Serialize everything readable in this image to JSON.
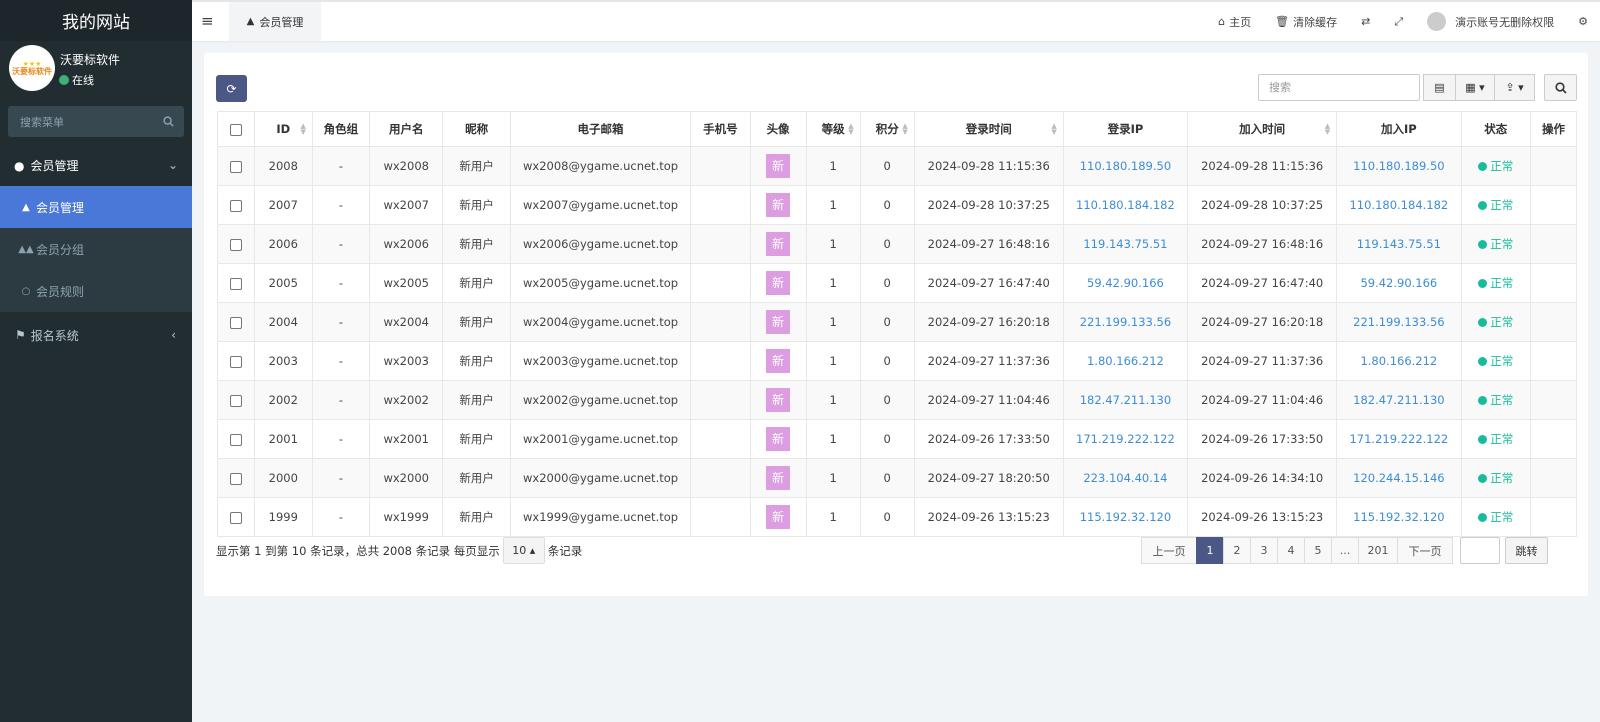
{
  "site": {
    "title": "我的网站"
  },
  "user": {
    "name": "沃要标软件",
    "status": "在线",
    "logo_text": "沃要标软件"
  },
  "sidebar": {
    "search_placeholder": "搜索菜单",
    "groups": [
      {
        "label": "会员管理",
        "items": [
          {
            "label": "会员管理",
            "icon": "user-icon"
          },
          {
            "label": "会员分组",
            "icon": "users-icon"
          },
          {
            "label": "会员规则",
            "icon": "circle-icon"
          }
        ]
      },
      {
        "label": "报名系统",
        "items": []
      }
    ]
  },
  "header": {
    "active_tab": "会员管理",
    "home": "主页",
    "clear_cache": "清除缓存",
    "account": "演示账号无删除权限"
  },
  "toolbar": {
    "search_placeholder": "搜索"
  },
  "table": {
    "columns": [
      "ID",
      "角色组",
      "用户名",
      "昵称",
      "电子邮箱",
      "手机号",
      "头像",
      "等级",
      "积分",
      "登录时间",
      "登录IP",
      "加入时间",
      "加入IP",
      "状态",
      "操作"
    ],
    "rows": [
      {
        "id": "2008",
        "group": "-",
        "username": "wx2008",
        "nickname": "新用户",
        "email": "wx2008@ygame.ucnet.top",
        "mobile": "",
        "avatar": "新",
        "level": "1",
        "score": "0",
        "login_time": "2024-09-28 11:15:36",
        "login_ip": "110.180.189.50",
        "join_time": "2024-09-28 11:15:36",
        "join_ip": "110.180.189.50",
        "status": "正常"
      },
      {
        "id": "2007",
        "group": "-",
        "username": "wx2007",
        "nickname": "新用户",
        "email": "wx2007@ygame.ucnet.top",
        "mobile": "",
        "avatar": "新",
        "level": "1",
        "score": "0",
        "login_time": "2024-09-28 10:37:25",
        "login_ip": "110.180.184.182",
        "join_time": "2024-09-28 10:37:25",
        "join_ip": "110.180.184.182",
        "status": "正常"
      },
      {
        "id": "2006",
        "group": "-",
        "username": "wx2006",
        "nickname": "新用户",
        "email": "wx2006@ygame.ucnet.top",
        "mobile": "",
        "avatar": "新",
        "level": "1",
        "score": "0",
        "login_time": "2024-09-27 16:48:16",
        "login_ip": "119.143.75.51",
        "join_time": "2024-09-27 16:48:16",
        "join_ip": "119.143.75.51",
        "status": "正常"
      },
      {
        "id": "2005",
        "group": "-",
        "username": "wx2005",
        "nickname": "新用户",
        "email": "wx2005@ygame.ucnet.top",
        "mobile": "",
        "avatar": "新",
        "level": "1",
        "score": "0",
        "login_time": "2024-09-27 16:47:40",
        "login_ip": "59.42.90.166",
        "join_time": "2024-09-27 16:47:40",
        "join_ip": "59.42.90.166",
        "status": "正常"
      },
      {
        "id": "2004",
        "group": "-",
        "username": "wx2004",
        "nickname": "新用户",
        "email": "wx2004@ygame.ucnet.top",
        "mobile": "",
        "avatar": "新",
        "level": "1",
        "score": "0",
        "login_time": "2024-09-27 16:20:18",
        "login_ip": "221.199.133.56",
        "join_time": "2024-09-27 16:20:18",
        "join_ip": "221.199.133.56",
        "status": "正常"
      },
      {
        "id": "2003",
        "group": "-",
        "username": "wx2003",
        "nickname": "新用户",
        "email": "wx2003@ygame.ucnet.top",
        "mobile": "",
        "avatar": "新",
        "level": "1",
        "score": "0",
        "login_time": "2024-09-27 11:37:36",
        "login_ip": "1.80.166.212",
        "join_time": "2024-09-27 11:37:36",
        "join_ip": "1.80.166.212",
        "status": "正常"
      },
      {
        "id": "2002",
        "group": "-",
        "username": "wx2002",
        "nickname": "新用户",
        "email": "wx2002@ygame.ucnet.top",
        "mobile": "",
        "avatar": "新",
        "level": "1",
        "score": "0",
        "login_time": "2024-09-27 11:04:46",
        "login_ip": "182.47.211.130",
        "join_time": "2024-09-27 11:04:46",
        "join_ip": "182.47.211.130",
        "status": "正常"
      },
      {
        "id": "2001",
        "group": "-",
        "username": "wx2001",
        "nickname": "新用户",
        "email": "wx2001@ygame.ucnet.top",
        "mobile": "",
        "avatar": "新",
        "level": "1",
        "score": "0",
        "login_time": "2024-09-26 17:33:50",
        "login_ip": "171.219.222.122",
        "join_time": "2024-09-26 17:33:50",
        "join_ip": "171.219.222.122",
        "status": "正常"
      },
      {
        "id": "2000",
        "group": "-",
        "username": "wx2000",
        "nickname": "新用户",
        "email": "wx2000@ygame.ucnet.top",
        "mobile": "",
        "avatar": "新",
        "level": "1",
        "score": "0",
        "login_time": "2024-09-27 18:20:50",
        "login_ip": "223.104.40.14",
        "join_time": "2024-09-26 14:34:10",
        "join_ip": "120.244.15.146",
        "status": "正常"
      },
      {
        "id": "1999",
        "group": "-",
        "username": "wx1999",
        "nickname": "新用户",
        "email": "wx1999@ygame.ucnet.top",
        "mobile": "",
        "avatar": "新",
        "level": "1",
        "score": "0",
        "login_time": "2024-09-26 13:15:23",
        "login_ip": "115.192.32.120",
        "join_time": "2024-09-26 13:15:23",
        "join_ip": "115.192.32.120",
        "status": "正常"
      }
    ]
  },
  "pagination": {
    "info_prefix": "显示第 1 到第 10 条记录，总共 2008 条记录 每页显示",
    "page_size": "10",
    "info_suffix": "条记录",
    "prev": "上一页",
    "pages": [
      "1",
      "2",
      "3",
      "4",
      "5",
      "...",
      "201"
    ],
    "next": "下一页",
    "jump": "跳转"
  },
  "colors": {
    "sidebar_bg": "#222d32",
    "active_menu": "#4978d8",
    "primary_btn": "#4b5785",
    "ip_link": "#3c8dd5",
    "status_ok": "#18bc9c",
    "avatar_new": "#dc9ee0"
  }
}
